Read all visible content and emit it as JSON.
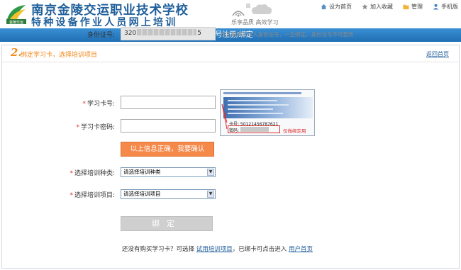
{
  "header": {
    "school_name": "南京金陵交运职业技术学校",
    "school_subtitle": "特种设备作业人员网上培训",
    "slogan": "乐享品质 高效学习",
    "logo_text": "金陵交运",
    "links": [
      {
        "label": "设为首页",
        "icon": "home-icon"
      },
      {
        "label": "加入收藏",
        "icon": "star-icon"
      },
      {
        "label": "管理",
        "icon": "folder-icon"
      },
      {
        "label": "手机版",
        "icon": "user-icon"
      }
    ]
  },
  "title_bar": "账号注册/绑定",
  "step": {
    "number": "2.",
    "title": "绑定学习卡，选择培训项目",
    "back_link": "返回首页"
  },
  "form": {
    "id_label": "身份证号:",
    "id_prefix": "320",
    "id_suffix": "5",
    "id_hint": "请正确填写本人身份证号，一旦绑定，身份证号不可更改",
    "card_no_label": "学习卡号:",
    "card_no_value": "",
    "card_pwd_label": "学习卡密码:",
    "card_pwd_value": "",
    "required_mark": "*",
    "confirm_button": "以上信息正确，我要确认",
    "category_label": "选择培训种类:",
    "category_selected": "请选择培训种类",
    "project_label": "选择培训项目:",
    "project_selected": "请选择培训项目",
    "submit_button": "绑定"
  },
  "card_sample": {
    "card_number": "卡号: 50121456787621",
    "password_label": "密码:",
    "note": "仅做绑定用"
  },
  "bottom": {
    "prefix": "还没有购买学习卡？可选择",
    "trial_link": "试用培训项目",
    "middle": "，已绑卡可点击进入",
    "home_link": "用户首页"
  },
  "colors": {
    "brand_blue": "#1f5f9b",
    "title_bar": "#2a7fc6",
    "accent_orange": "#f5894a",
    "required_red": "#e03030"
  }
}
